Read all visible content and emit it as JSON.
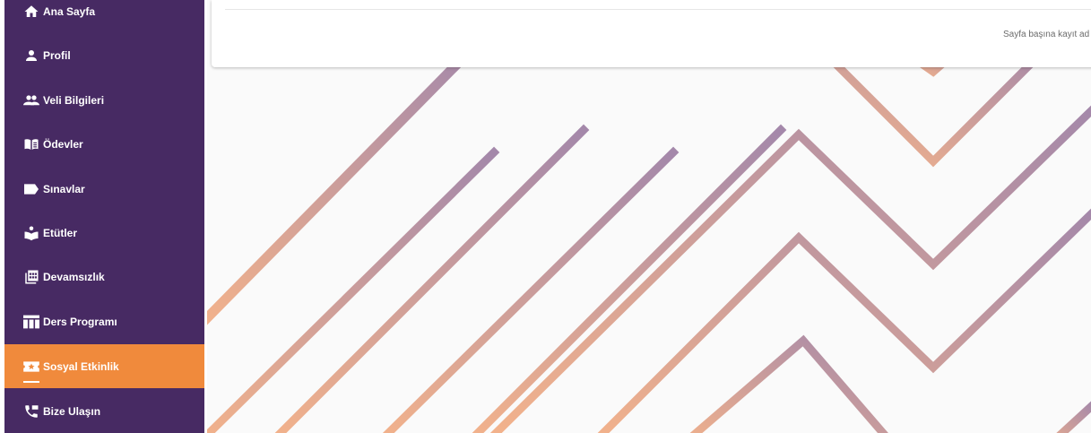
{
  "sidebar": {
    "items": [
      {
        "label": "Ana Sayfa",
        "icon": "home-icon"
      },
      {
        "label": "Profil",
        "icon": "person-icon"
      },
      {
        "label": "Veli Bilgileri",
        "icon": "people-icon"
      },
      {
        "label": "Ödevler",
        "icon": "book-icon"
      },
      {
        "label": "Sınavlar",
        "icon": "label-icon"
      },
      {
        "label": "Etütler",
        "icon": "study-icon"
      },
      {
        "label": "Devamsızlık",
        "icon": "calendar-icon"
      },
      {
        "label": "Ders Programı",
        "icon": "table-icon"
      },
      {
        "label": "Sosyal Etkinlik",
        "icon": "ticket-icon",
        "active": true
      },
      {
        "label": "Bize Ulaşın",
        "icon": "phone-icon"
      }
    ]
  },
  "main": {
    "per_page_label": "Sayfa başına kayıt ad"
  },
  "colors": {
    "sidebar_bg": "#472a63",
    "active_bg": "#f08a3c",
    "stripe_start": "#f6b48a",
    "stripe_end": "#a488aa"
  }
}
